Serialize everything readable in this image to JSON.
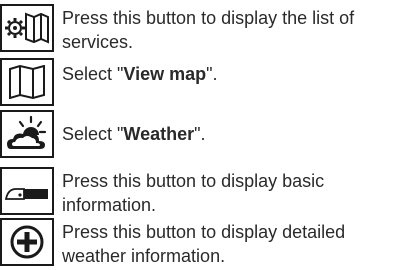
{
  "steps": [
    {
      "icon": "services-map-icon",
      "text": "Press this button to display the list of services."
    },
    {
      "icon": "map-icon",
      "pre": "Select \"",
      "bold": "View map",
      "post": "\"."
    },
    {
      "icon": "weather-icon",
      "pre": "Select \"",
      "bold": "Weather",
      "post": "\"."
    },
    {
      "icon": "basic-info-button-icon",
      "text": "Press this button to display basic information."
    },
    {
      "icon": "plus-circle-icon",
      "text": "Press this button to display detailed weather information."
    }
  ]
}
